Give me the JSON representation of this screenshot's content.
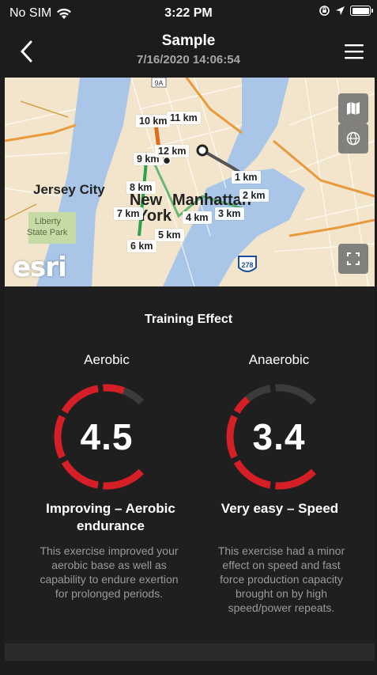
{
  "status_bar": {
    "carrier": "No SIM",
    "time": "3:22 PM"
  },
  "nav": {
    "title": "Sample",
    "subtitle": "7/16/2020 14:06:54"
  },
  "map": {
    "city_labels": [
      "Jersey City",
      "New",
      "York",
      "Manhattan",
      "Liberty",
      "State Park"
    ],
    "km_markers": [
      "1 km",
      "2 km",
      "3 km",
      "4 km",
      "5 km",
      "6 km",
      "7 km",
      "8 km",
      "9 km",
      "10 km",
      "11 km",
      "12 km"
    ],
    "attribution": "esri",
    "shield_label": "278",
    "route_label": "9A"
  },
  "training_effect": {
    "title": "Training Effect",
    "aerobic": {
      "label": "Aerobic",
      "value": "4.5",
      "score": 4.5,
      "headline": "Improving – Aerobic endurance",
      "description": "This exercise improved your aerobic base as well as capability to endure exertion for prolonged periods."
    },
    "anaerobic": {
      "label": "Anaerobic",
      "value": "3.4",
      "score": 3.4,
      "headline": "Very easy – Speed",
      "description": "This exercise had a minor effect on speed and fast force production capacity brought on by high speed/power repeats."
    }
  },
  "colors": {
    "gauge_active": "#d41f26",
    "gauge_inactive": "#3a3b3a",
    "background": "#1b1c1b"
  },
  "icons": [
    "wifi-icon",
    "lock-rotation-icon",
    "location-arrow-icon",
    "battery-icon",
    "back-chevron-icon",
    "menu-icon",
    "map-layers-icon",
    "globe-icon",
    "fullscreen-icon"
  ]
}
